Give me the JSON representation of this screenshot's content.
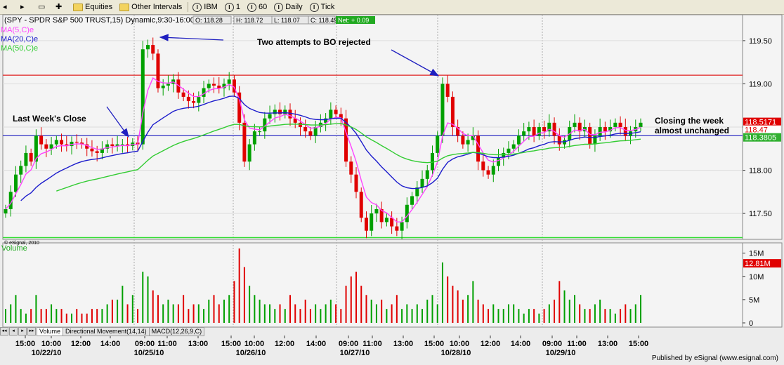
{
  "toolbar": {
    "items": [
      "Equities",
      "Other Intervals",
      "IBM",
      "1",
      "60",
      "Daily",
      "Tick"
    ],
    "item_icons": [
      "folder-icon",
      "folder-icon",
      "circle-i-icon",
      "circle-i-icon",
      "circle-i-icon",
      "circle-i-icon",
      "circle-i-icon"
    ]
  },
  "header": {
    "symbol_title": "(SPY - SPDR S&P 500 TRUST,15) Dynamic,9:30-16:00",
    "ma5": "MA(5,C)e",
    "ma20": "MA(20,C)e",
    "ma50": "MA(50,C)e",
    "ohlc": [
      "O: 118.28",
      "H: 118.72",
      "L: 118.07",
      "C: 118.49"
    ],
    "net": "Net: + 0.09",
    "copyright": "© eSignal, 2010"
  },
  "annotations": {
    "last_week_close": "Last Week's Close",
    "two_attempts": "Two attempts to BO rejected",
    "closing": [
      "Closing the week",
      "almost unchanged"
    ]
  },
  "volume_label": "Volume",
  "tabs": [
    "Volume",
    "Directional Movement(14,14)",
    "MACD(12,26,9,C)"
  ],
  "footer": "Published by eSignal (www.esignal.com)",
  "colors": {
    "up": "#00a000",
    "down": "#e00000",
    "ma5": "#ff44ff",
    "ma20": "#1c1ccc",
    "ma50": "#33cc33",
    "resistance": "#e02020",
    "support": "#2020c0",
    "base_line": "#33dd33",
    "arrow": "#2020c0"
  },
  "chart_data": {
    "type": "candlestick",
    "symbol": "SPY",
    "interval": "15 min",
    "price_ylim": [
      117.2,
      119.8
    ],
    "price_ticks": [
      "119.50",
      "119.00",
      "118.50",
      "118.00",
      "117.50"
    ],
    "price_labels": [
      "118.5171",
      "118.47",
      "118.3805"
    ],
    "volume_ylim": [
      0,
      16
    ],
    "volume_ticks": [
      "15M",
      "10M",
      "5M",
      "0"
    ],
    "volume_last_label": "12.81M",
    "x_ticks": [
      "15:00",
      "10:00",
      "12:00",
      "14:00",
      "09:00",
      "11:00",
      "13:00",
      "15:00",
      "10:00",
      "12:00",
      "14:00",
      "09:00",
      "11:00",
      "13:00",
      "15:00",
      "10:00",
      "12:00",
      "14:00",
      "09:00",
      "11:00",
      "13:00",
      "15:00"
    ],
    "date_labels": [
      "10/22/10",
      "10/25/10",
      "10/26/10",
      "10/27/10",
      "10/28/10",
      "10/29/10"
    ],
    "horizontal_lines": {
      "resistance": 119.1,
      "support": 118.4,
      "base": 117.22
    },
    "closes": [
      117.55,
      117.75,
      117.95,
      118.05,
      118.2,
      118.1,
      118.4,
      118.3,
      118.25,
      118.3,
      118.35,
      118.3,
      118.28,
      118.33,
      118.32,
      118.3,
      118.25,
      118.22,
      118.2,
      118.25,
      118.3,
      118.28,
      118.3,
      118.3,
      118.28,
      118.32,
      118.3,
      119.4,
      119.45,
      119.35,
      118.95,
      118.98,
      119.0,
      119.05,
      118.9,
      118.85,
      118.8,
      118.78,
      118.85,
      118.95,
      119.0,
      118.98,
      118.95,
      119.0,
      119.05,
      118.9,
      118.55,
      118.1,
      118.3,
      118.45,
      118.45,
      118.6,
      118.65,
      118.7,
      118.65,
      118.7,
      118.6,
      118.55,
      118.5,
      118.45,
      118.4,
      118.5,
      118.55,
      118.6,
      118.7,
      118.65,
      118.6,
      118.1,
      117.95,
      117.75,
      117.45,
      117.3,
      117.5,
      117.55,
      117.4,
      117.45,
      117.35,
      117.3,
      117.4,
      117.6,
      117.7,
      117.8,
      117.9,
      118.0,
      118.2,
      118.4,
      119.0,
      118.85,
      118.5,
      118.4,
      118.3,
      118.35,
      118.4,
      118.1,
      118.0,
      117.95,
      118.05,
      118.15,
      118.2,
      118.25,
      118.3,
      118.4,
      118.45,
      118.5,
      118.4,
      118.5,
      118.45,
      118.55,
      118.4,
      118.3,
      118.35,
      118.5,
      118.55,
      118.45,
      118.5,
      118.3,
      118.4,
      118.5,
      118.45,
      118.5,
      118.55,
      118.5,
      118.4,
      118.45,
      118.5,
      118.55
    ],
    "volume_millions": [
      3,
      4,
      6,
      3,
      2,
      3,
      6,
      3,
      3,
      4,
      3,
      3,
      2,
      2,
      3,
      2,
      2,
      3,
      3,
      3,
      4,
      5,
      5,
      8,
      4,
      6,
      3,
      11,
      10,
      7,
      6,
      4,
      5,
      4,
      4,
      6,
      3,
      4,
      4,
      3,
      5,
      6,
      4,
      5,
      6,
      9,
      16,
      12,
      8,
      6,
      5,
      4,
      4,
      3,
      4,
      3,
      6,
      4,
      3,
      5,
      3,
      4,
      3,
      4,
      5,
      4,
      3,
      8,
      10,
      11,
      8,
      6,
      5,
      4,
      5,
      3,
      4,
      6,
      3,
      4,
      3,
      4,
      3,
      5,
      6,
      4,
      13,
      10,
      8,
      7,
      5,
      6,
      9,
      5,
      4,
      3,
      4,
      3,
      3,
      4,
      4,
      3,
      2,
      3,
      3,
      2,
      3,
      4,
      5,
      9,
      7,
      5,
      6,
      4,
      3,
      3,
      4,
      5,
      3,
      3,
      2,
      3,
      4,
      3,
      4,
      6
    ]
  }
}
